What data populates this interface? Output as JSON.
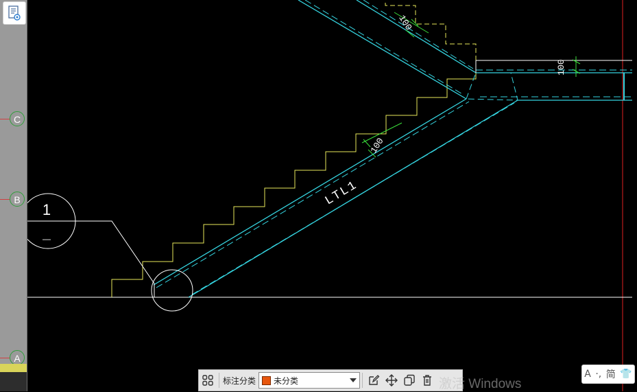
{
  "axes": [
    {
      "id": "C",
      "label": "C"
    },
    {
      "id": "B",
      "label": "B"
    },
    {
      "id": "A",
      "label": "A"
    }
  ],
  "drawing": {
    "stair_label": "LTL1",
    "dim_upper": "100",
    "dim_lower": "100",
    "dim_right": "100",
    "section_mark_top": "1",
    "section_mark_bottom": "—"
  },
  "toolbar": {
    "label": "标注分类",
    "dropdown_value": "未分类",
    "dropdown_swatch_color": "#e8570e"
  },
  "watermark": "激活 Windows",
  "ime": {
    "mode": "A",
    "dot": "·,",
    "chinese": "简",
    "shirt": "👕"
  },
  "colors": {
    "cad_bg": "#000000",
    "cyan": "#35d4e0",
    "yellow": "#e8e85a",
    "green": "#3be03b",
    "white": "#ffffff",
    "red": "#e02020"
  }
}
